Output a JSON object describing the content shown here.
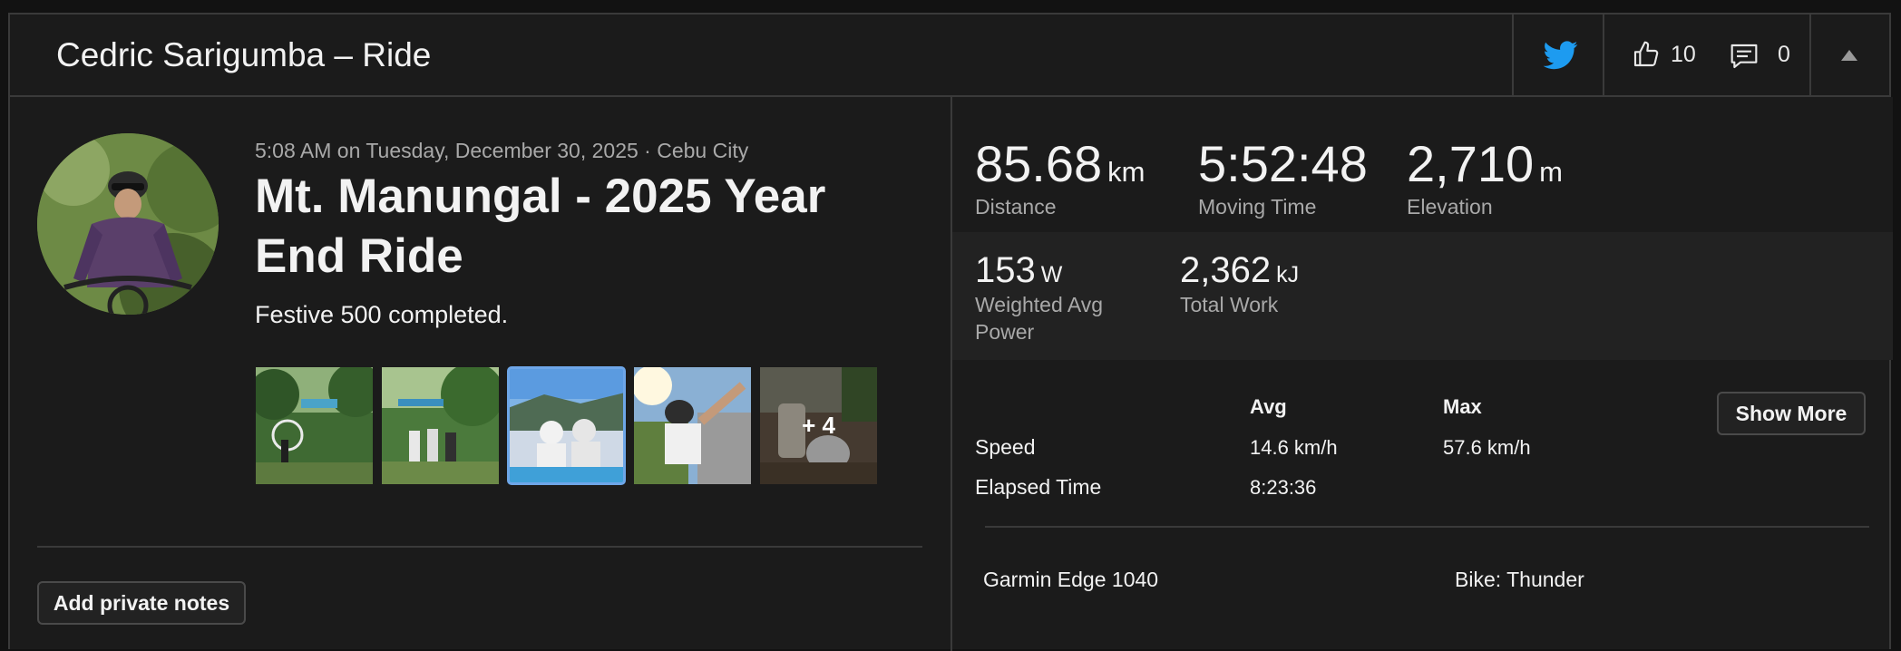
{
  "header": {
    "title": "Cedric Sarigumba – Ride",
    "kudos_count": "10",
    "comment_count": "0",
    "icons": {
      "share": "twitter-icon",
      "kudos": "thumbs-up-icon",
      "comments": "comment-icon",
      "collapse": "caret-up-icon"
    },
    "twitter_color": "#1d9bf0"
  },
  "activity": {
    "meta": "5:08 AM on Tuesday, December 30, 2025 · Cebu City",
    "title": "Mt. Manungal - 2025 Year End Ride",
    "description": "Festive 500 completed.",
    "photos": [
      {
        "name": "photo-1",
        "selected": false
      },
      {
        "name": "photo-2",
        "selected": false
      },
      {
        "name": "photo-3",
        "selected": true
      },
      {
        "name": "photo-4",
        "selected": false
      },
      {
        "name": "photo-5",
        "selected": false,
        "overlay": "+ 4"
      }
    ],
    "notes_button": "Add private notes"
  },
  "stats": {
    "distance": {
      "value": "85.68",
      "unit": "km",
      "label": "Distance"
    },
    "moving_time": {
      "value": "5:52:48",
      "label": "Moving Time"
    },
    "elevation": {
      "value": "2,710",
      "unit": "m",
      "label": "Elevation"
    },
    "weighted_power": {
      "value": "153",
      "unit": "W",
      "label": "Weighted Avg Power"
    },
    "total_work": {
      "value": "2,362",
      "unit": "kJ",
      "label": "Total Work"
    }
  },
  "details": {
    "col_avg": "Avg",
    "col_max": "Max",
    "rows": [
      {
        "label": "Speed",
        "avg": "14.6 km/h",
        "max": "57.6 km/h"
      },
      {
        "label": "Elapsed Time",
        "avg": "8:23:36",
        "max": ""
      }
    ],
    "show_more": "Show More",
    "device": "Garmin Edge 1040",
    "bike": "Bike: Thunder"
  },
  "colors": {
    "accent": "#6ea6e8",
    "background": "#1b1b1b",
    "band": "#222222",
    "muted_text": "#a9a9a9"
  }
}
